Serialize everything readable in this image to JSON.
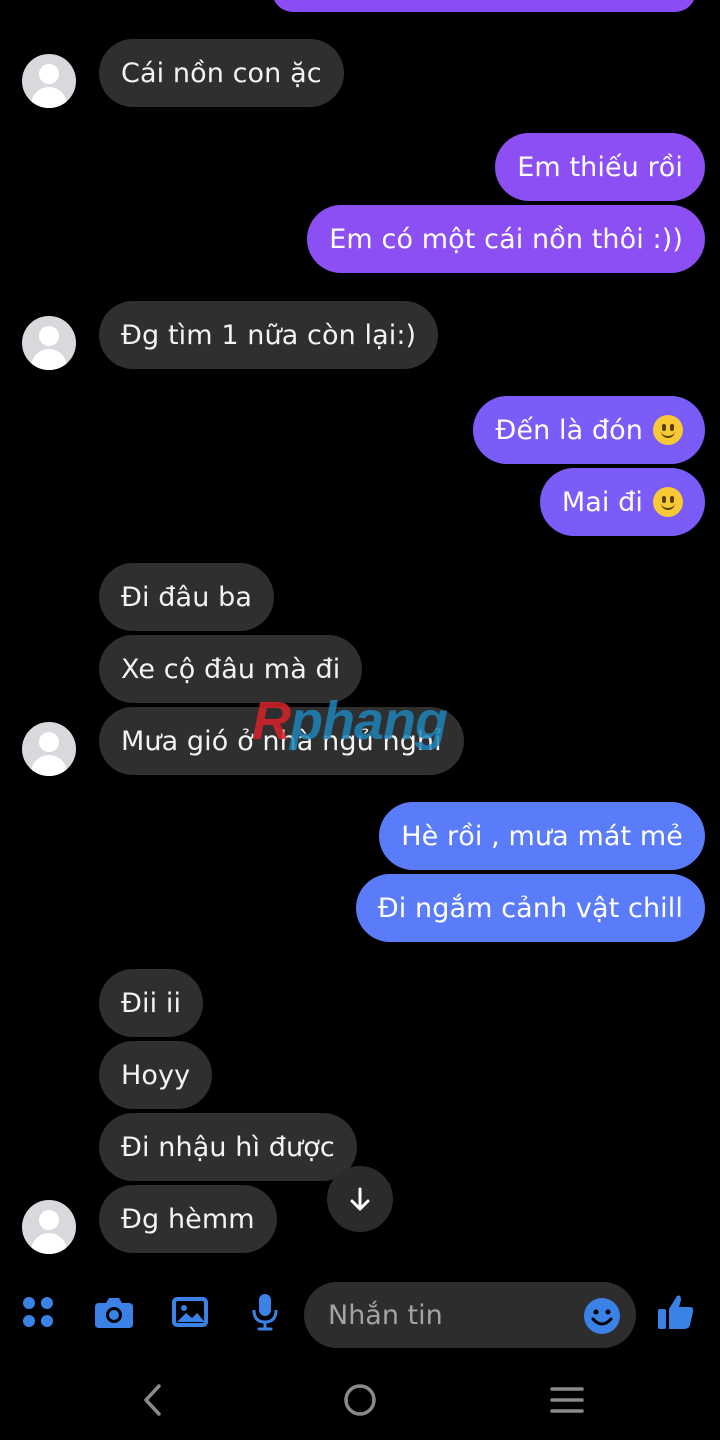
{
  "conversation": {
    "messages": [
      {
        "direction": "incoming",
        "text": "Cái nồn con ặc"
      },
      {
        "direction": "outgoing",
        "text": "Em thiếu rồi"
      },
      {
        "direction": "outgoing",
        "text": "Em có một cái nồn thôi :))"
      },
      {
        "direction": "incoming",
        "text": "Đg tìm 1 nữa còn lại:)"
      },
      {
        "direction": "outgoing",
        "text": "Đến là đón",
        "emoji": "slightly-smiling-face"
      },
      {
        "direction": "outgoing",
        "text": "Mai đi",
        "emoji": "slightly-smiling-face"
      },
      {
        "direction": "incoming",
        "text": "Đi đâu ba"
      },
      {
        "direction": "incoming",
        "text": "Xe cộ đâu mà đi"
      },
      {
        "direction": "incoming",
        "text": "Mưa gió ở nhà ngủ nghỉ"
      },
      {
        "direction": "outgoing",
        "text": "Hè rồi , mưa mát mẻ"
      },
      {
        "direction": "outgoing",
        "text": "Đi ngắm cảnh vật chill"
      },
      {
        "direction": "incoming",
        "text": "Đii ii"
      },
      {
        "direction": "incoming",
        "text": "Hoyy"
      },
      {
        "direction": "incoming",
        "text": "Đi nhậu hì được"
      },
      {
        "direction": "incoming",
        "text": "Đg hèmm"
      }
    ]
  },
  "watermark": {
    "first_letter": "R",
    "rest": "phang"
  },
  "composer": {
    "placeholder": "Nhắn tin",
    "icons": [
      "apps-icon",
      "camera-icon",
      "gallery-icon",
      "microphone-icon",
      "emoji-icon",
      "like-thumb-icon"
    ]
  },
  "navigation": {
    "icons": [
      "back-icon",
      "home-icon",
      "recent-apps-icon"
    ]
  },
  "colors": {
    "background": "#000000",
    "incoming_bubble": "#2f2f2f",
    "outgoing_purple": "#8c4ff4",
    "outgoing_violet": "#7b5cf8",
    "outgoing_blue": "#5b7cf9",
    "accent_blue": "#3b82e6",
    "composer_background": "#2d2d2d"
  }
}
